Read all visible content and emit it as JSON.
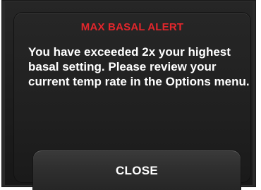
{
  "alert": {
    "title": "MAX BASAL ALERT",
    "message": "You have exceeded 2x your highest basal setting. Please review your current temp rate in the Options menu.",
    "close_label": "CLOSE"
  },
  "colors": {
    "title": "#e3262c",
    "background": "#1d1d1d",
    "text": "#ffffff"
  }
}
